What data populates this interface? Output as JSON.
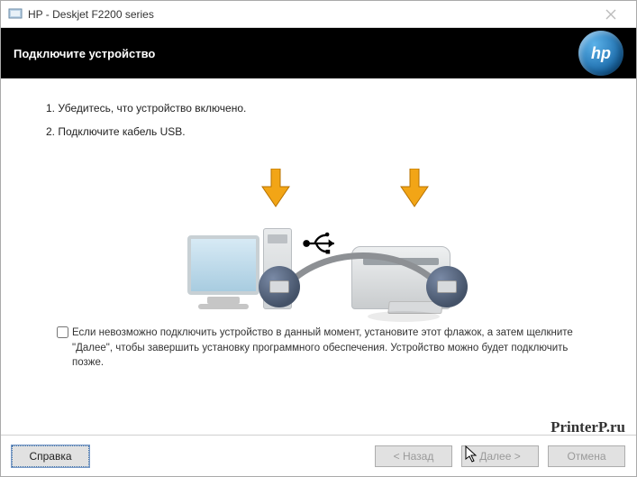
{
  "window": {
    "title": "HP - Deskjet F2200 series"
  },
  "header": {
    "heading": "Подключите устройство",
    "logo_text": "hp"
  },
  "steps": {
    "s1": "1. Убедитесь, что устройство включено.",
    "s2": "2. Подключите кабель USB."
  },
  "checkbox": {
    "label": "Если невозможно подключить устройство в данный момент, установите этот флажок, а затем щелкните \"Далее\", чтобы завершить установку программного обеспечения. Устройство можно будет подключить позже."
  },
  "buttons": {
    "help": "Справка",
    "back": "< Назад",
    "next": "Далее >",
    "cancel": "Отмена"
  },
  "watermark": "PrinterP.ru"
}
